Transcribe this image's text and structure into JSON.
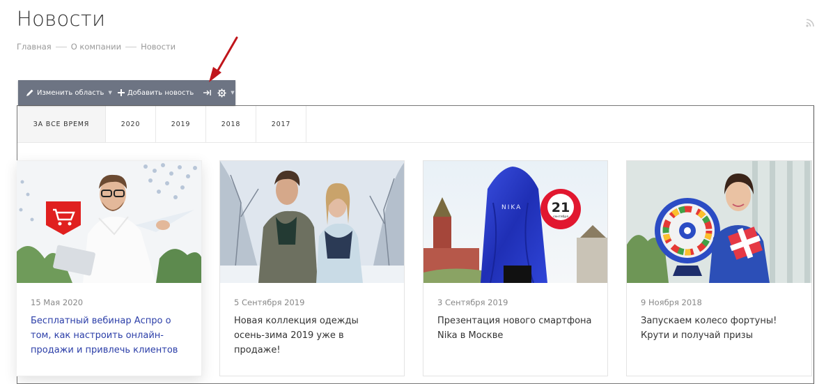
{
  "page": {
    "title": "Новости"
  },
  "breadcrumb": {
    "items": [
      "Главная",
      "О компании",
      "Новости"
    ]
  },
  "toolbar": {
    "edit_area": "Изменить область",
    "add_news": "Добавить новость"
  },
  "tabs": [
    {
      "label": "ЗА ВСЕ ВРЕМЯ",
      "active": true
    },
    {
      "label": "2020"
    },
    {
      "label": "2019"
    },
    {
      "label": "2018"
    },
    {
      "label": "2017"
    }
  ],
  "news": [
    {
      "date": "15 Мая 2020",
      "title": "Бесплатный вебинар Аспро о том, как настроить онлайн-продажи и привлечь клиентов",
      "active": true
    },
    {
      "date": "5 Сентября 2019",
      "title": "Новая коллекция одежды осень-зима 2019 уже в продаже!"
    },
    {
      "date": "3 Сентября 2019",
      "title": "Презентация нового смартфона Nika в Москве",
      "image_text": {
        "brand": "NIKA",
        "day": "21",
        "month": "сентября"
      }
    },
    {
      "date": "9 Ноября 2018",
      "title": "Запускаем колесо фортуны! Крути и получай призы"
    }
  ],
  "colors": {
    "accent_link": "#2b3ea8",
    "toolbar_bg": "#6d7483",
    "arrow": "#c0151b"
  }
}
